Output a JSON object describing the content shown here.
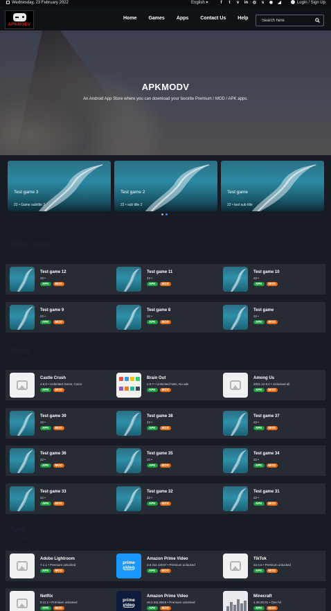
{
  "topbar": {
    "date": "Wednesday, 23 February 2022",
    "language": "English",
    "socials": [
      "facebook-icon",
      "twitter-icon",
      "vimeo-icon",
      "linkedin-icon",
      "instagram-icon",
      "skype-icon",
      "github-icon",
      "rss-icon"
    ],
    "social_glyphs": [
      "f",
      "t",
      "v",
      "in",
      "◎",
      "s",
      "◉",
      "◢"
    ],
    "login": "Login / Sign Up"
  },
  "navbar": {
    "logo_text": "APKMODV",
    "menu": [
      "Home",
      "Games",
      "Apps",
      "Contact Us",
      "Help"
    ],
    "search_placeholder": "Search here"
  },
  "hero": {
    "title": "APKMODV",
    "subtitle": "An Android App Store where you can download your favorite Premium / MOD / APK apps."
  },
  "slider": {
    "slides": [
      {
        "title": "Test game 3",
        "subtitle": "22 • Game subtitle 3"
      },
      {
        "title": "Test game 2",
        "subtitle": "22 • sub title 2"
      },
      {
        "title": "Test game",
        "subtitle": "22 • test sub title"
      }
    ],
    "active_index": 1
  },
  "sections": {
    "editors": {
      "title": "Editor Choice",
      "subtitle": "Popular games and apps of the week, hand picked by our editors"
    },
    "games": {
      "title": "Games",
      "subtitle": "Latest updated games"
    },
    "apps": {
      "title": "Apps",
      "subtitle": "Latest updated apps"
    }
  },
  "badges": {
    "apk": "APK",
    "mod": "MOD"
  },
  "editor_rows": [
    [
      {
        "name": "Test game 12",
        "meta": "22 •"
      },
      {
        "name": "Test game 11",
        "meta": "22 •"
      },
      {
        "name": "Test game 10",
        "meta": "22 •"
      }
    ],
    [
      {
        "name": "Test game 9",
        "meta": "22 •"
      },
      {
        "name": "Test game 8",
        "meta": "22 •"
      },
      {
        "name": "Test game",
        "meta": "22 •"
      }
    ]
  ],
  "game_rows": [
    [
      {
        "name": "Castle Crush",
        "meta": "4.6.0 • Unlimited Gems, Coins",
        "thumb": "placeholder"
      },
      {
        "name": "Brain Out",
        "meta": "2.0.7 • Unlimited hints, No ads",
        "thumb": "brain"
      },
      {
        "name": "Among Us",
        "meta": "2021.12.9.0 • Unlocked all",
        "thumb": "placeholder"
      }
    ],
    [
      {
        "name": "Test game 39",
        "meta": "22 •"
      },
      {
        "name": "Test game 38",
        "meta": "22 •"
      },
      {
        "name": "Test game 37",
        "meta": "22 •"
      }
    ],
    [
      {
        "name": "Test game 36",
        "meta": "22 •"
      },
      {
        "name": "Test game 35",
        "meta": "22 •"
      },
      {
        "name": "Test game 34",
        "meta": "22 •"
      }
    ],
    [
      {
        "name": "Test game 33",
        "meta": "22 •"
      },
      {
        "name": "Test game 32",
        "meta": "22 •"
      },
      {
        "name": "Test game 31",
        "meta": "22 •"
      }
    ]
  ],
  "app_rows": [
    [
      {
        "name": "Adobe Lightroom",
        "meta": "7.1.1 • Premium unlocked",
        "thumb": "placeholder"
      },
      {
        "name": "Amazon Prime Video",
        "meta": "3.0.311.12047 • Premium unlocked",
        "thumb": "prime",
        "logo_text": "prime video"
      },
      {
        "name": "TikTok",
        "meta": "22.4.5 • Premium unlocked",
        "thumb": "placeholder"
      }
    ],
    [
      {
        "name": "Netflix",
        "meta": "8.11.1 • Premium unlocked",
        "thumb": "placeholder"
      },
      {
        "name": "Amazon Prime Video",
        "meta": "v6.0.311.8945 • Premium unlocked",
        "thumb": "prime2",
        "logo_text": "prime video"
      },
      {
        "name": "Minecraft",
        "meta": "1.40.20.01 • One hit",
        "thumb": "minecraft"
      }
    ]
  ],
  "colors": {
    "accent": "#2d8cff",
    "apk_badge": "#1f9b3f",
    "mod_badge": "#e86a12",
    "background": "#161b24",
    "card": "#262b34"
  }
}
